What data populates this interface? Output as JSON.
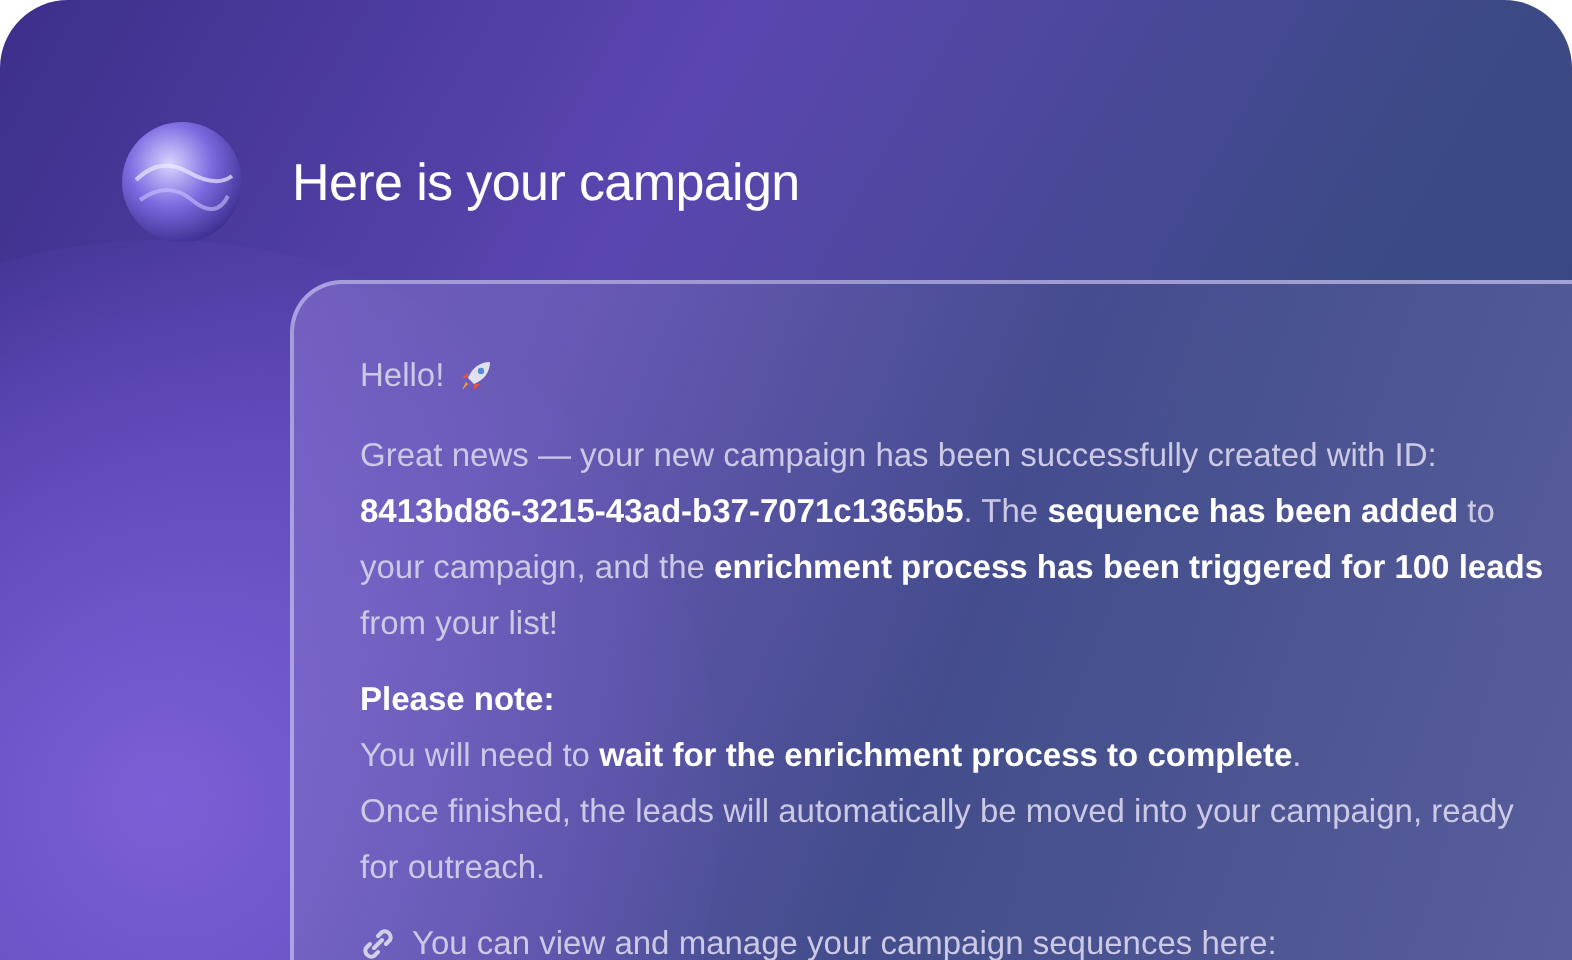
{
  "header": {
    "title": "Here is your campaign"
  },
  "message": {
    "greeting": "Hello!",
    "paragraphs": [
      {
        "kind": "body",
        "text": "Great news — your new campaign has been successfully created with ID: **8413bd86-3215-43ad-b37-7071c1365b5**. The **sequence has been added** to your campaign, and the **enrichment process has been triggered for 100 leads** from your list!"
      },
      {
        "kind": "heading",
        "text": "Please note:"
      },
      {
        "kind": "note",
        "text": "You will need to **wait for the enrichment process to complete**."
      },
      {
        "kind": "body",
        "text": "Once finished, the leads will automatically be moved into your campaign, ready for outreach."
      },
      {
        "kind": "link-line",
        "text": "You can view and manage your campaign sequences here:"
      }
    ]
  }
}
